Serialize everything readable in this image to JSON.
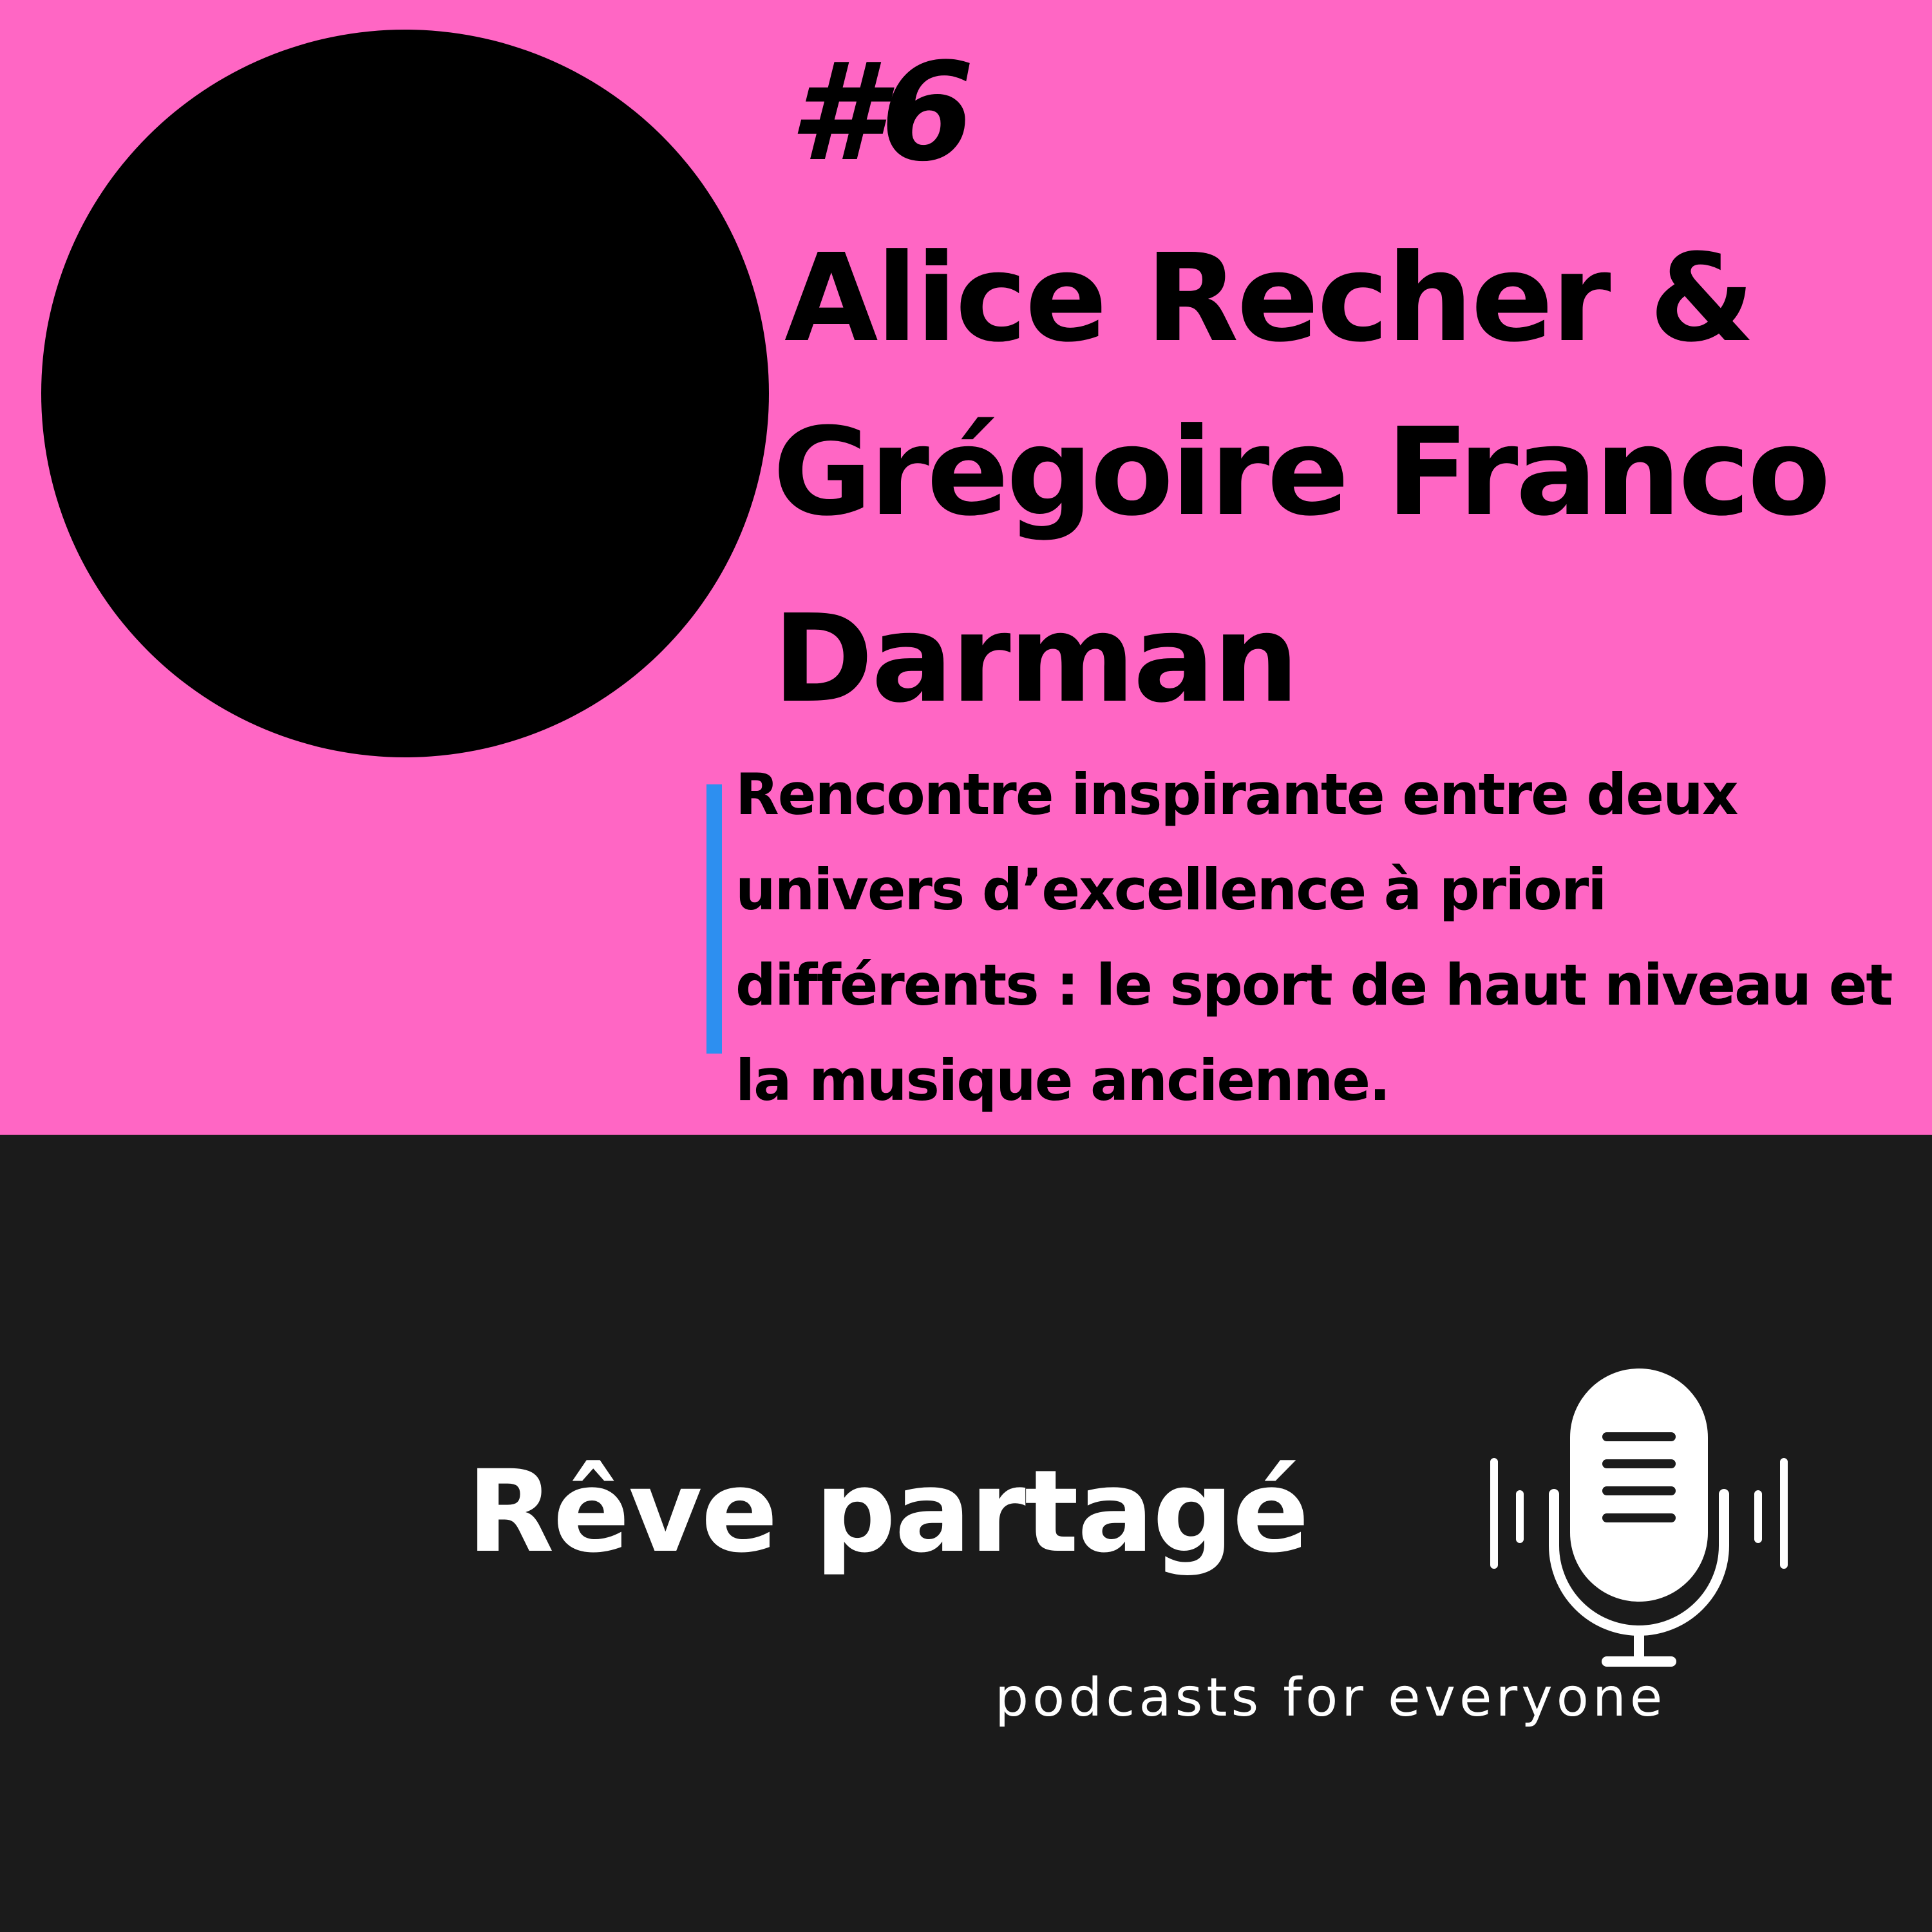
{
  "colors": {
    "top_background": "#ff66c4",
    "bottom_background": "#1b1b1b",
    "accent": "#2d8ff0",
    "text_dark": "#000000",
    "text_light": "#ffffff"
  },
  "episode": {
    "number": "#6",
    "guest_line_1": "Alice Recher &",
    "guest_line_2": "Grégoire Franco",
    "guest_line_3": "Darman",
    "description": "Rencontre inspirante entre deux univers d’excellence à priori différents : le sport de haut niveau et la musique ancienne."
  },
  "brand": {
    "name": "Rêve partagé",
    "tagline": "podcasts for everyone",
    "icon": "microphone-icon"
  }
}
